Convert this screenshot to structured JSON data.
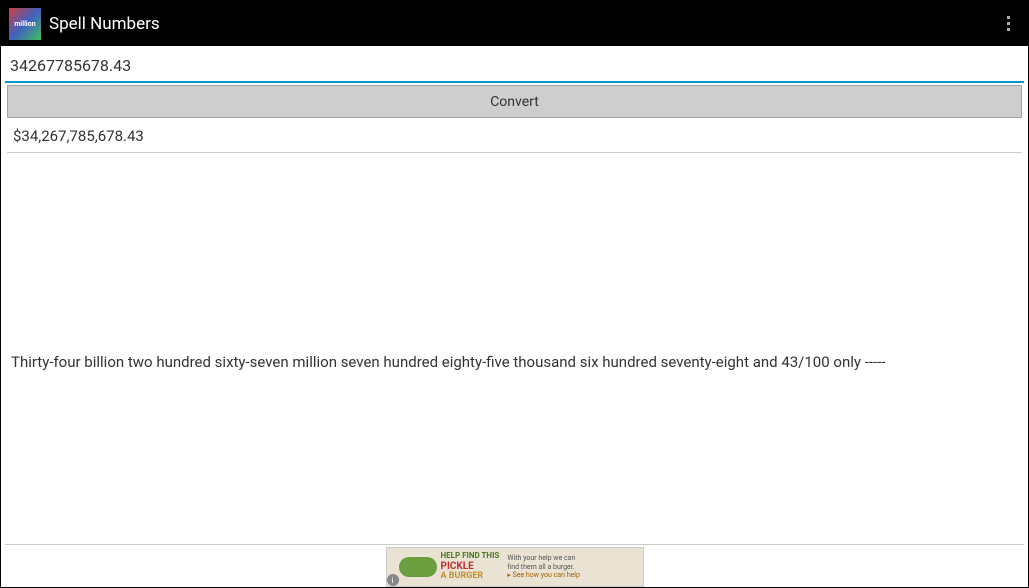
{
  "header": {
    "app_icon_text": "million",
    "title": "Spell Numbers"
  },
  "input": {
    "value": "34267785678.43"
  },
  "button": {
    "convert_label": "Convert"
  },
  "output": {
    "formatted": "$34,267,785,678.43",
    "spelled": "Thirty-four billion two hundred sixty-seven million seven hundred eighty-five thousand six hundred seventy-eight and 43/100 only -----"
  },
  "ad": {
    "line1": "HELP FIND THIS",
    "line2": "PICKLE",
    "line3": "A BURGER",
    "right1": "With your help we can",
    "right2": "find them all a burger.",
    "right3": "▸ See how you can help"
  }
}
